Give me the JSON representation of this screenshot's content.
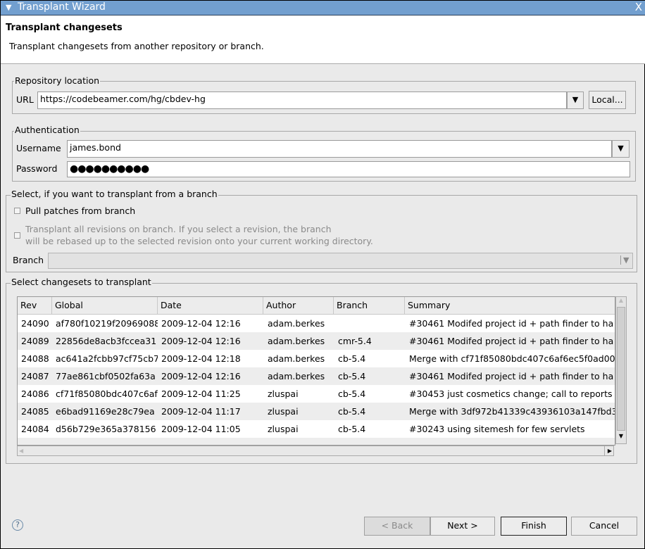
{
  "window": {
    "title": "Transplant Wizard",
    "close_label": "X"
  },
  "header": {
    "title": "Transplant changesets",
    "description": "Transplant changesets from another repository or branch."
  },
  "repository": {
    "legend": "Repository location",
    "url_label": "URL",
    "url_value": "https://codebeamer.com/hg/cbdev-hg",
    "local_button": "Local..."
  },
  "auth": {
    "legend": "Authentication",
    "username_label": "Username",
    "username_value": "james.bond",
    "password_label": "Password",
    "password_value": "●●●●●●●●●●"
  },
  "branch_section": {
    "legend": "Select, if you want to transplant from a branch",
    "pull_label": "Pull patches from branch",
    "pull_checked": false,
    "all_revs_line1": "Transplant all revisions on branch. If you select a revision, the branch",
    "all_revs_line2": "will be rebased up to the selected revision onto your current working directory.",
    "all_revs_checked": false,
    "branch_label": "Branch",
    "branch_value": ""
  },
  "changesets": {
    "legend": "Select changesets to transplant",
    "columns": [
      "Rev",
      "Global",
      "Date",
      "Author",
      "Branch",
      "Summary"
    ],
    "rows": [
      [
        "24090",
        "af780f10219f20969088",
        "2009-12-04 12:16",
        "adam.berkes",
        "",
        "#30461 Modifed project id + path finder to ha"
      ],
      [
        "24089",
        "22856de8acb3fccea31",
        "2009-12-04 12:16",
        "adam.berkes",
        "cmr-5.4",
        "#30461 Modifed project id + path finder to ha"
      ],
      [
        "24088",
        "ac641a2fcbb97cf75cb7",
        "2009-12-04 12:18",
        "adam.berkes",
        "cb-5.4",
        "Merge with cf71f85080bdc407c6af6ec5f0ad00"
      ],
      [
        "24087",
        "77ae861cbf0502fa63a",
        "2009-12-04 12:16",
        "adam.berkes",
        "cb-5.4",
        "#30461 Modifed project id + path finder to ha"
      ],
      [
        "24086",
        "cf71f85080bdc407c6af",
        "2009-12-04 11:25",
        "zluspai",
        "cb-5.4",
        "#30453 just cosmetics change; call to reports"
      ],
      [
        "24085",
        "e6bad91169e28c79ea",
        "2009-12-04 11:17",
        "zluspai",
        "cb-5.4",
        "Merge with 3df972b41339c43936103a147fbd3"
      ],
      [
        "24084",
        "d56b729e365a378156",
        "2009-12-04 11:05",
        "zluspai",
        "cb-5.4",
        "#30243 using sitemesh for few servlets"
      ]
    ]
  },
  "buttons": {
    "back": "< Back",
    "next": "Next >",
    "finish": "Finish",
    "cancel": "Cancel"
  }
}
